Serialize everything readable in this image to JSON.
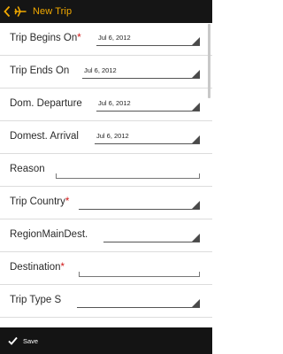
{
  "header": {
    "title": "New Trip"
  },
  "form": {
    "trip_begins_on": {
      "label": "Trip Begins On",
      "required_mark": "*",
      "value": "Jul 6, 2012"
    },
    "trip_ends_on": {
      "label": "Trip Ends On",
      "value": "Jul 6, 2012"
    },
    "dom_departure": {
      "label": "Dom. Departure",
      "value": "Jul 6, 2012"
    },
    "domest_arrival": {
      "label": "Domest. Arrival",
      "value": "Jul 6, 2012"
    },
    "reason": {
      "label": "Reason",
      "value": ""
    },
    "trip_country": {
      "label": "Trip Country",
      "required_mark": "*",
      "value": ""
    },
    "region_main_dest": {
      "label": "RegionMainDest.",
      "value": ""
    },
    "destination": {
      "label": "Destination",
      "required_mark": "*",
      "value": ""
    },
    "trip_type": {
      "label": "Trip Type S",
      "value": ""
    }
  },
  "footer": {
    "save_label": "Save"
  },
  "icons": {
    "back": "chevron-left-icon",
    "app": "airplane-icon",
    "save": "check-icon"
  },
  "colors": {
    "accent": "#f2a900",
    "required": "#d01616",
    "bar_background": "#151515"
  }
}
